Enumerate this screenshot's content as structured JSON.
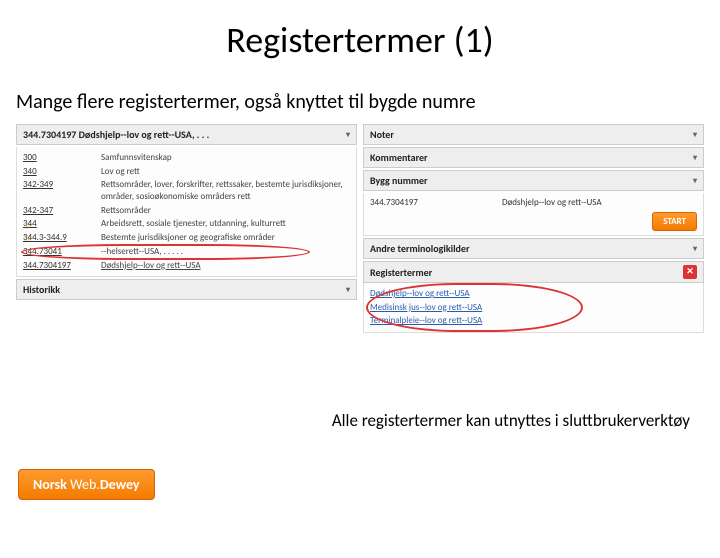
{
  "title": "Registertermer (1)",
  "subtitle": "Mange flere registertermer, også knyttet til bygde numre",
  "left": {
    "header": "344.7304197 Dødshjelp--lov og rett--USA, . . .",
    "rows": [
      {
        "code": "300",
        "desc": "Samfunnsvitenskap"
      },
      {
        "code": "340",
        "desc": "Lov og rett"
      },
      {
        "code": "342-349",
        "desc": "Rettsområder, lover, forskrifter, rettssaker, bestemte jurisdiksjoner, områder, sosioøkonomiske områders rett"
      },
      {
        "code": "342-347",
        "desc": "Rettsområder"
      },
      {
        "code": "344",
        "desc": "Arbeidsrett, sosiale tjenester, utdanning, kulturrett"
      },
      {
        "code": "344.3-344.9",
        "desc": "Bestemte jurisdiksjoner og geografiske områder"
      },
      {
        "code": "344.7304197",
        "desc": "Dødshjelp--lov og rett--USA"
      }
    ],
    "highlight_code": "344.73041",
    "highlight_desc": "--helserett--USA, . . . . .",
    "historikk": "Historikk"
  },
  "right": {
    "noter": "Noter",
    "kommentarer": "Kommentarer",
    "bygg": {
      "header": "Bygg nummer",
      "code": "344.7304197",
      "desc": "Dødshjelp--lov og rett--USA",
      "start": "START"
    },
    "kilder": "Andre terminologikilder",
    "reg": {
      "header": "Registertermer",
      "items": [
        "Dødshjelp--lov og rett--USA",
        "Medisinsk jus--lov og rett--USA",
        "Terminalpleie--lov og rett--USA"
      ]
    }
  },
  "footnote": "Alle registertermer kan utnyttes i sluttbrukerverktøy",
  "brand_a": "Norsk ",
  "brand_b": "Web.",
  "brand_c": "Dewey"
}
